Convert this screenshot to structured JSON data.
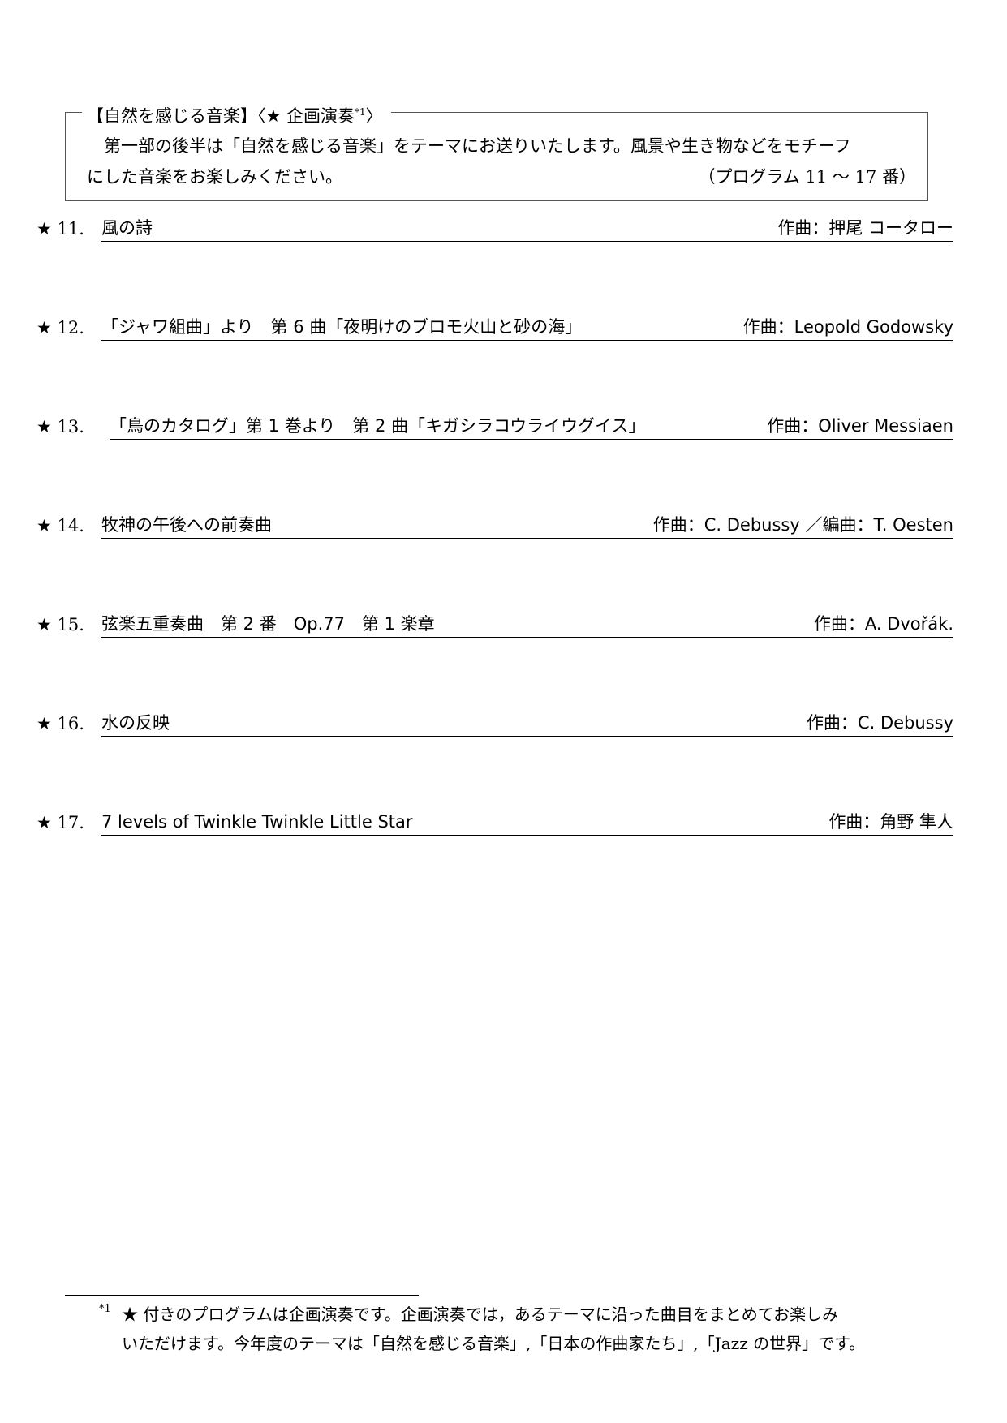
{
  "theme_box": {
    "title": "【自然を感じる音楽】〈★ 企画演奏",
    "title_footnote_ref": "*1",
    "title_close": "〉",
    "body_line1": "第一部の後半は「自然を感じる音楽」をテーマにお送りいたします。風景や生き物などをモチーフ",
    "body_line2": "にした音楽をお楽しみください。",
    "program_range": "（プログラム 11 〜 17 番）"
  },
  "programs": [
    {
      "number": "★ 11.",
      "title": "風の詩",
      "composer": "作曲：押尾 コータロー"
    },
    {
      "number": "★ 12.",
      "title": "「ジャワ組曲」より　第 6 曲「夜明けのブロモ火山と砂の海」",
      "composer": "作曲：Leopold Godowsky"
    },
    {
      "number": "★ 13.",
      "title": "「鳥のカタログ」第 1 巻より　第 2 曲「キガシラコウライウグイス」",
      "composer": "作曲：Oliver Messiaen"
    },
    {
      "number": "★ 14.",
      "title": "牧神の午後への前奏曲",
      "composer": "作曲：C. Debussy ／編曲：T. Oesten"
    },
    {
      "number": "★ 15.",
      "title": "弦楽五重奏曲　第 2 番　Op.77　第 1 楽章",
      "composer": "作曲：A. Dvořák."
    },
    {
      "number": "★ 16.",
      "title": "水の反映",
      "composer": "作曲：C. Debussy"
    },
    {
      "number": "★ 17.",
      "title": "7 levels of Twinkle Twinkle Little Star",
      "composer": "作曲：角野 隼人"
    }
  ],
  "footnote": {
    "mark": "*1",
    "line1": "★ 付きのプログラムは企画演奏です。企画演奏では，あるテーマに沿った曲目をまとめてお楽しみ",
    "line2": "いただけます。今年度のテーマは「自然を感じる音楽」,「日本の作曲家たち」,「Jazz の世界」です。"
  }
}
